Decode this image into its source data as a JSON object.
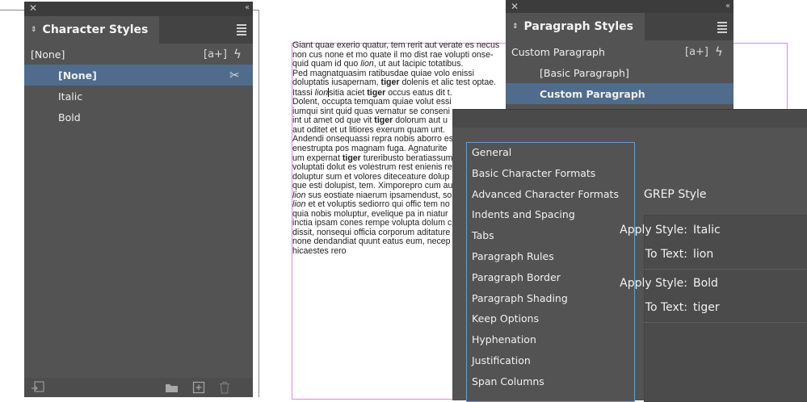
{
  "document": {
    "lines": [
      [
        {
          "t": "Giant quae exerio quatur, tem rerit aut verate es necus"
        }
      ],
      [
        {
          "t": "non cus none et mo quate il mo dist rae volupti onse-"
        }
      ],
      [
        {
          "t": "quid quam id quo "
        },
        {
          "t": "lion",
          "i": true
        },
        {
          "t": ", ut aut lacipic totatibus."
        }
      ],
      [
        {
          "t": "Ped magnatquasim ratibusdae quiae volo enissi"
        }
      ],
      [
        {
          "t": "doluptatis iusapernam, "
        },
        {
          "t": "tiger",
          "b": true
        },
        {
          "t": " dolenis et alic test optae."
        }
      ],
      [
        {
          "t": "Itassi "
        },
        {
          "t": "lion",
          "i": true
        },
        {
          "cursor": true
        },
        {
          "t": "sitia aciet "
        },
        {
          "t": "tiger",
          "b": true
        },
        {
          "t": " occus eatus dit t."
        }
      ],
      [
        {
          "t": "Dolent, occupta temquam quiae volut essi"
        }
      ],
      [
        {
          "t": "iumqui sint quid quas vernatur se conseni"
        }
      ],
      [
        {
          "t": "int ut amet od que vit "
        },
        {
          "t": "tiger",
          "b": true
        },
        {
          "t": " dolorum aut u"
        }
      ],
      [
        {
          "t": "aut oditet et ut litiores exerum quam unt."
        }
      ],
      [
        {
          "t": "Andendi onsequassi repra nobis aborro es"
        }
      ],
      [
        {
          "t": "enestrupta pos magnam fuga. Agnaturite"
        }
      ],
      [
        {
          "t": "um expernat "
        },
        {
          "t": "tiger",
          "b": true
        },
        {
          "t": " tureribusto beratiassum"
        }
      ],
      [
        {
          "t": "voluptati dolut es volestrum rest enienis re"
        }
      ],
      [
        {
          "t": "doluptur sum et volores diteceature dolup"
        }
      ],
      [
        {
          "t": "que esti dolupist, tem. Ximporepro cum au"
        }
      ],
      [
        {
          "t": "lion",
          "i": true
        },
        {
          "t": " sus eostiate niaerum ipsamendust, so"
        }
      ],
      [
        {
          "t": "lion",
          "i": true
        },
        {
          "t": " et et voluptis sediorro qui offic tem no"
        }
      ],
      [
        {
          "t": "quia nobis moluptur, evelique pa in niatur"
        }
      ],
      [
        {
          "t": "inctia ipsam cones rempe volupta dolum c"
        }
      ],
      [
        {
          "t": "dissit, nonsequi officia corporum aditature"
        }
      ],
      [
        {
          "t": "none dendandiat quunt eatus eum, necep"
        }
      ],
      [
        {
          "t": "hicaestes rero"
        }
      ]
    ]
  },
  "character_styles": {
    "title": "Character Styles",
    "current": "[None]",
    "items": [
      {
        "label": "[None]",
        "selected": true
      },
      {
        "label": "Italic",
        "selected": false
      },
      {
        "label": "Bold",
        "selected": false
      }
    ],
    "create_label": "[a+]"
  },
  "paragraph_styles": {
    "title": "Paragraph Styles",
    "current": "Custom Paragraph",
    "items": [
      {
        "label": "[Basic Paragraph]",
        "selected": false
      },
      {
        "label": "Custom Paragraph",
        "selected": true
      }
    ],
    "create_label": "[a+]"
  },
  "dialog": {
    "categories": [
      "General",
      "Basic Character Formats",
      "Advanced Character Formats",
      "Indents and Spacing",
      "Tabs",
      "Paragraph Rules",
      "Paragraph Border",
      "Paragraph Shading",
      "Keep Options",
      "Hyphenation",
      "Justification",
      "Span Columns"
    ],
    "section_title": "GREP Style",
    "grep_rules": [
      {
        "apply_label": "Apply Style:",
        "style": "Italic",
        "text_label": "To Text:",
        "text": "lion"
      },
      {
        "apply_label": "Apply Style:",
        "style": "Bold",
        "text_label": "To Text:",
        "text": "tiger"
      }
    ]
  },
  "colors": {
    "panel_bg": "#535353",
    "selection": "#4f6c8c",
    "margin_guide": "#d98cd9",
    "focus_border": "#6e9bd1"
  }
}
